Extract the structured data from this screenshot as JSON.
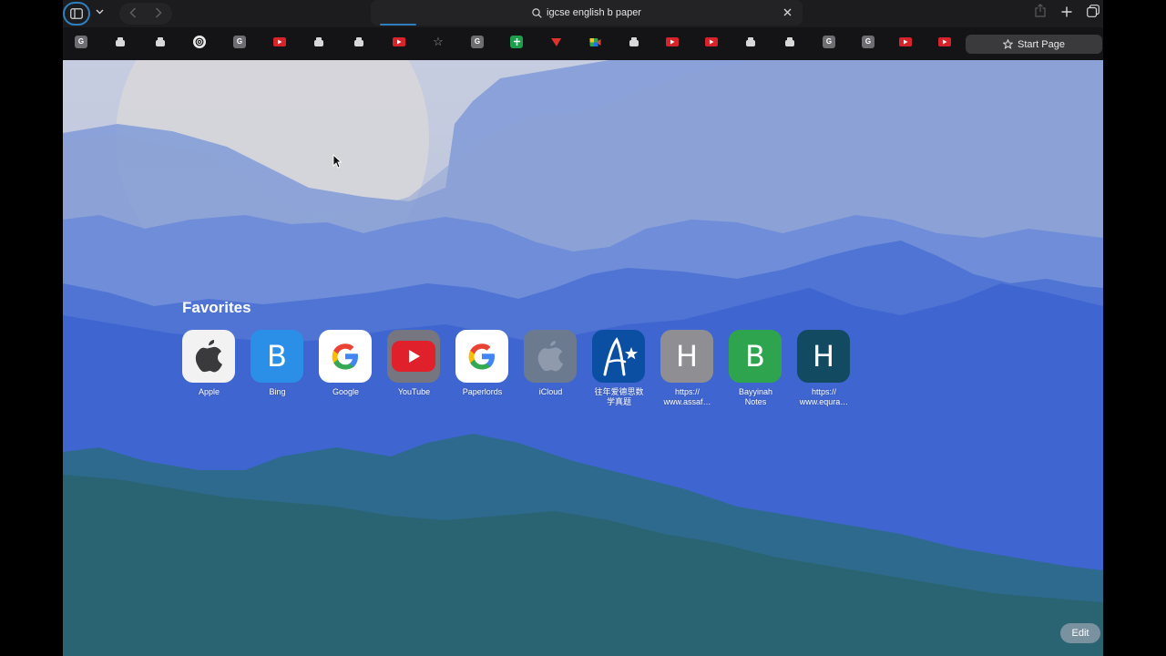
{
  "toolbar": {
    "address_text": "igcse english b paper",
    "icons": [
      "sidebar-icon",
      "chevron-down-icon",
      "back-icon",
      "forward-icon",
      "search-icon",
      "clear-icon",
      "share-icon",
      "plus-icon",
      "tabs-overview-icon"
    ]
  },
  "tabs": {
    "favicon_labels": [
      "G",
      "G",
      "G",
      "G",
      "G"
    ],
    "start_page_label": "Start Page"
  },
  "favorites": {
    "title": "Favorites",
    "items": [
      {
        "label": "Apple",
        "letter": ""
      },
      {
        "label": "Bing",
        "letter": "B"
      },
      {
        "label": "Google",
        "letter": ""
      },
      {
        "label": "YouTube",
        "letter": ""
      },
      {
        "label": "Paperlords",
        "letter": ""
      },
      {
        "label": "iCloud",
        "letter": ""
      },
      {
        "label_line1": "往年爱德思数",
        "label_line2": "学真题",
        "letter": ""
      },
      {
        "label_line1": "https://",
        "label_line2": "www.assaf…",
        "letter": "H"
      },
      {
        "label_line1": "Bayyinah",
        "label_line2": "Notes",
        "letter": "B"
      },
      {
        "label_line1": "https://",
        "label_line2": "www.equra…",
        "letter": "H"
      }
    ]
  },
  "edit_label": "Edit",
  "colors": {
    "accent": "#2f7fbf",
    "bing": "#2b8fe8",
    "youtube": "#e0202a",
    "bayyinah": "#2ea44f",
    "equra": "#124a62",
    "assaf": "#8e8e93",
    "zh_site": "#0b4fa3"
  }
}
